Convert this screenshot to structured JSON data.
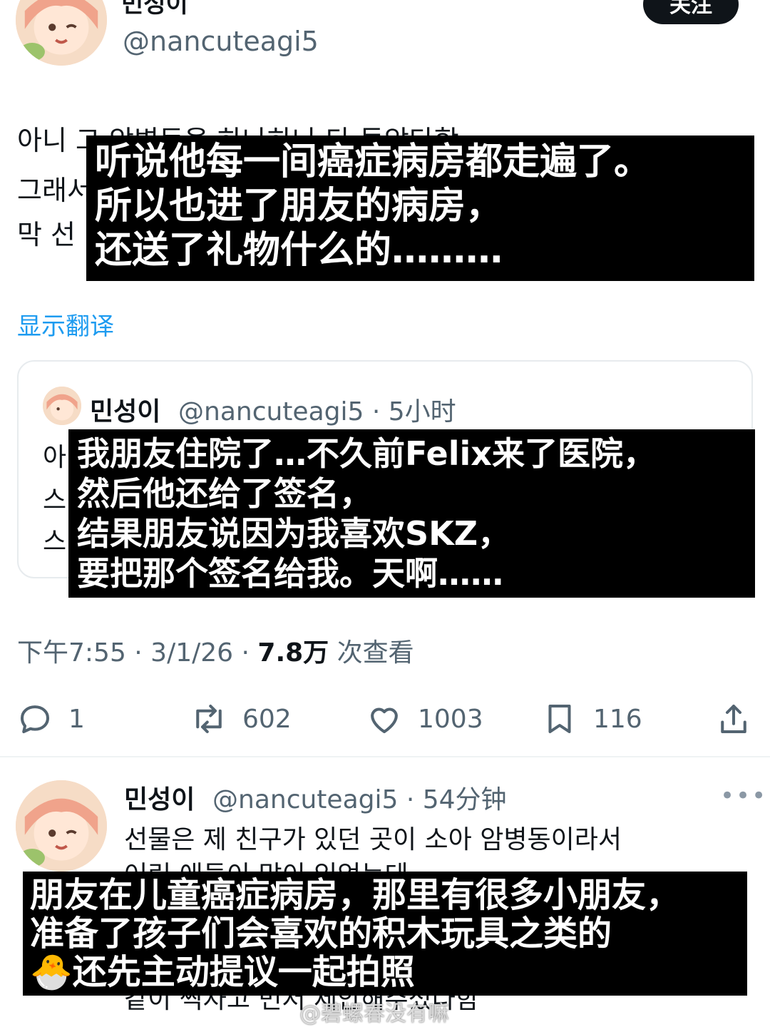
{
  "main_post": {
    "author_name": "민성이",
    "handle": "@nancuteagi5",
    "follow_label": "关注",
    "text_lines": [
      "아니 그 암병동을 하나하나 다 돌았다함",
      "그래서",
      "막 선"
    ],
    "translate_label": "显示翻译",
    "timestamp": "下午7:55 · 3/1/26 · ",
    "views_count": "7.8万",
    "views_label": " 次查看"
  },
  "quoted_post": {
    "author_name": "민성이",
    "handle_time": "@nancuteagi5 · 5小时",
    "text_lines": [
      "아",
      "스",
      "스"
    ]
  },
  "actions": {
    "reply_count": "1",
    "retweet_count": "602",
    "like_count": "1003",
    "bookmark_count": "116"
  },
  "reply_post": {
    "author_name": "민성이",
    "handle_time": "@nancuteagi5 · 54分钟",
    "more_label": "•••",
    "text_lines": [
      "선물은 제 친구가 있던 곳이 소아 암병동이라서",
      "어린 애들이 많이 있었는데",
      "같이 찍자고 먼저 제안해주셨다함"
    ]
  },
  "subtitles": {
    "sub1": [
      "听说他每一间癌症病房都走遍了。",
      "所以也进了朋友的病房，",
      "还送了礼物什么的………"
    ],
    "sub2": [
      "我朋友住院了…不久前Felix来了医院，",
      "然后他还给了签名，",
      "结果朋友说因为我喜欢SKZ，",
      "要把那个签名给我。天啊……"
    ],
    "sub3": [
      "朋友在儿童癌症病房，那里有很多小朋友，",
      "准备了孩子们会喜欢的积木玩具之类的",
      "还先主动提议一起拍照"
    ],
    "sub3_emoji": "🐣"
  },
  "watermark": "@碧螺春没有嘛",
  "colors": {
    "link": "#1d9bf0",
    "secondary": "#536471",
    "text": "#0f1419",
    "subtitle_bg": "#000000"
  },
  "icons": [
    "reply-icon",
    "retweet-icon",
    "like-icon",
    "bookmark-icon",
    "share-icon",
    "more-icon"
  ]
}
